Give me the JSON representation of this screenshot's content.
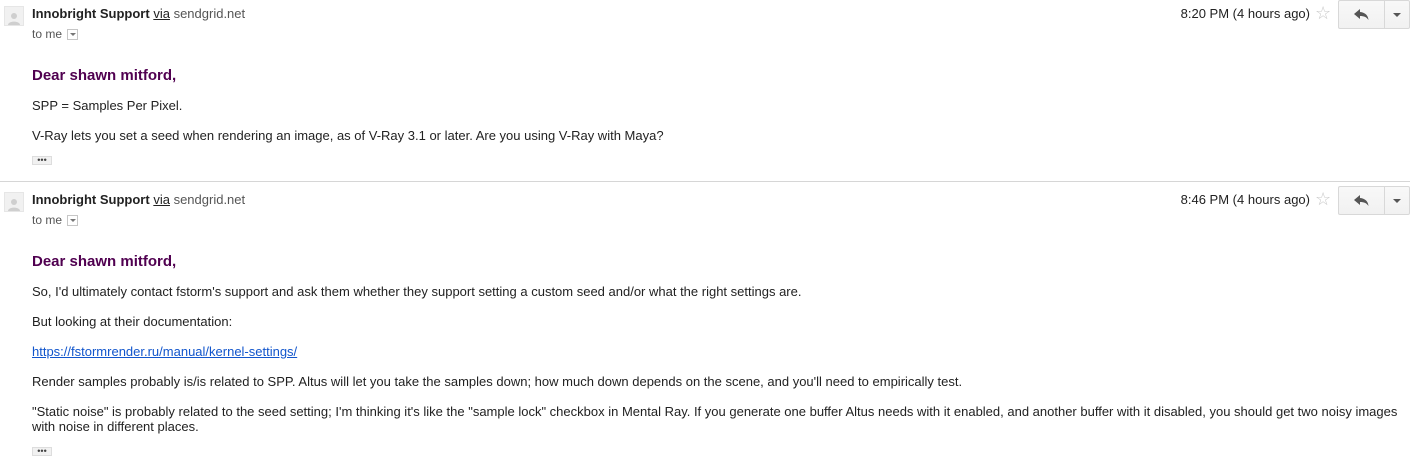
{
  "messages": [
    {
      "sender": "Innobright Support",
      "via_label": "via",
      "via_domain": "sendgrid.net",
      "to_label": "to me",
      "time": "8:20 PM (4 hours ago)",
      "greeting": "Dear shawn mitford,",
      "paragraphs": [
        "SPP = Samples Per Pixel.",
        "V-Ray lets you set a seed when rendering an image, as of V-Ray 3.1 or later. Are you using V-Ray with Maya?"
      ],
      "ellipsis": "•••"
    },
    {
      "sender": "Innobright Support",
      "via_label": "via",
      "via_domain": "sendgrid.net",
      "to_label": "to me",
      "time": "8:46 PM (4 hours ago)",
      "greeting": "Dear shawn mitford,",
      "paragraphs": [
        "So, I'd ultimately contact fstorm's support and ask them whether they support setting a custom seed and/or what the right settings are.",
        "But looking at their documentation:",
        "https://fstormrender.ru/manual/kernel-settings/",
        "Render samples probably is/is related to SPP. Altus will let you take the samples down; how much down depends on the scene, and you'll need to empirically test.",
        "\"Static noise\" is probably related to the seed setting; I'm thinking it's like the \"sample lock\" checkbox in Mental Ray. If you generate one buffer Altus needs with it enabled, and another buffer with it disabled, you should get two noisy images with noise in different places."
      ],
      "ellipsis": "•••"
    }
  ],
  "icons": {
    "avatar": "default-avatar-icon",
    "star": "star-icon",
    "reply": "reply-icon",
    "more": "chevron-down-icon"
  },
  "colors": {
    "greeting": "#500050",
    "link": "#1155cc",
    "star": "#c9c9c9"
  }
}
